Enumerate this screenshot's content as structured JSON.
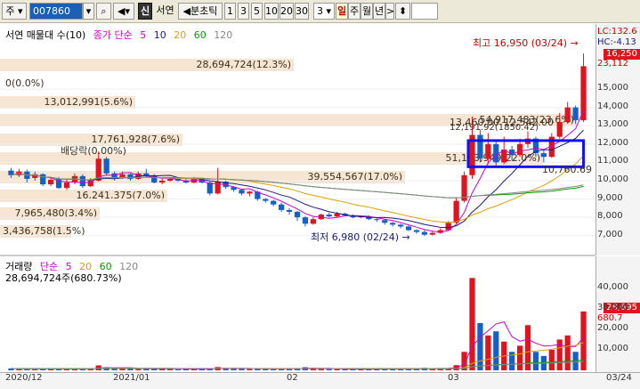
{
  "toolbar": {
    "market_select": "주",
    "code": "007860",
    "stock_name": "서연",
    "shin_badge": "신",
    "period_label": "분초틱",
    "period_buttons": [
      "1",
      "3",
      "5",
      "10",
      "20",
      "30"
    ],
    "count_value": "3",
    "day_button": "일",
    "week_button": "주",
    "month_button": "월",
    "year_button": "년"
  },
  "price_panel": {
    "legend_title": "서연 매물대 수(10)",
    "ma_label": "종가 단순",
    "ma_periods": [
      "5",
      "10",
      "20",
      "60",
      "120"
    ],
    "ma_colors": [
      "#cc00cc",
      "#1a1a80",
      "#e0a000",
      "#00a000",
      "#888888"
    ],
    "volume_profile": [
      "28,694,724(12.3%)",
      "0(0.0%)",
      "13,012,991(5.6%)",
      "54,917,483(23.6%)",
      "17,761,928(7.6%)",
      "51,103,949(22.0%)",
      "39,554,567(17.0%)",
      "16,241,375(7.0%)",
      "7,965,480(3.4%)",
      "3,436,758(1.5%)"
    ],
    "annotations": {
      "dividend": "배당락(0.00%)",
      "high": "최고 16,950 (03/24)",
      "low": "최저 6,980 (02/24)",
      "box_upper": "13,460.00",
      "box_upper_pct": "12,542.00",
      "box_mid": "12,191.92(1850.42)",
      "box_lower": "10,760.69"
    },
    "right_labels": {
      "lc": "LC:132.6",
      "hc": "HC:-4.13",
      "last_price": "16,250",
      "prev": "23,112"
    },
    "y_ticks": [
      "15,000",
      "14,000",
      "13,000",
      "12,000",
      "11,000",
      "10,000",
      "9,000",
      "8,000",
      "7,000"
    ]
  },
  "volume_panel": {
    "legend_title": "거래량",
    "ma_label": "단순",
    "ma_periods": [
      "5",
      "20",
      "60",
      "120"
    ],
    "ma_colors": [
      "#cc00cc",
      "#e0a000",
      "#00a000",
      "#888888"
    ],
    "last_volume_text": "28,694,724주(680.73%)",
    "right_labels": {
      "last_volume": "28,695",
      "pct": "680.7"
    },
    "y_ticks": [
      "40,000",
      "30,000",
      "20,000",
      "10,000"
    ]
  },
  "x_axis": {
    "labels": [
      "2020/12",
      "2021/01",
      "02",
      "03",
      "03/24"
    ]
  },
  "colors": {
    "up": "#e0141e",
    "down": "#1460c8",
    "band": "#f6e5d3",
    "box": "#1010ff"
  },
  "chart_data": {
    "type": "candlestick",
    "price_range": [
      6500,
      16950
    ],
    "volume_range": [
      0,
      46000
    ],
    "x_categories": [
      "2020/12",
      "2021/01",
      "02",
      "03",
      "03/24"
    ],
    "ma_series": [
      {
        "name": "5"
      },
      {
        "name": "10"
      },
      {
        "name": "20"
      },
      {
        "name": "60"
      },
      {
        "name": "120"
      }
    ],
    "candles": [
      {
        "o": 10550,
        "c": 10300,
        "h": 10700,
        "l": 10150
      },
      {
        "o": 10300,
        "c": 10500,
        "h": 10650,
        "l": 10200
      },
      {
        "o": 10500,
        "c": 10100,
        "h": 10600,
        "l": 9900
      },
      {
        "o": 10150,
        "c": 10350,
        "h": 10500,
        "l": 10000
      },
      {
        "o": 10350,
        "c": 9800,
        "h": 10400,
        "l": 9700
      },
      {
        "o": 9800,
        "c": 10050,
        "h": 10200,
        "l": 9700
      },
      {
        "o": 10100,
        "c": 9600,
        "h": 10200,
        "l": 9550
      },
      {
        "o": 9600,
        "c": 9900,
        "h": 10050,
        "l": 9500
      },
      {
        "o": 9900,
        "c": 10250,
        "h": 10400,
        "l": 9800
      },
      {
        "o": 10250,
        "c": 9700,
        "h": 10350,
        "l": 9600
      },
      {
        "o": 9700,
        "c": 10000,
        "h": 10150,
        "l": 9650
      },
      {
        "o": 10000,
        "c": 11200,
        "h": 11600,
        "l": 9950
      },
      {
        "o": 11200,
        "c": 10400,
        "h": 11300,
        "l": 10300
      },
      {
        "o": 10400,
        "c": 10150,
        "h": 10500,
        "l": 10000
      },
      {
        "o": 10150,
        "c": 10350,
        "h": 10500,
        "l": 10100
      },
      {
        "o": 10350,
        "c": 10100,
        "h": 10400,
        "l": 10000
      },
      {
        "o": 10100,
        "c": 10400,
        "h": 10500,
        "l": 10050
      },
      {
        "o": 10400,
        "c": 10300,
        "h": 10650,
        "l": 10200
      },
      {
        "o": 10300,
        "c": 9900,
        "h": 10350,
        "l": 9850
      },
      {
        "o": 9900,
        "c": 10000,
        "h": 10100,
        "l": 9800
      },
      {
        "o": 10000,
        "c": 10100,
        "h": 10150,
        "l": 9950
      },
      {
        "o": 10100,
        "c": 10000,
        "h": 10150,
        "l": 9950
      },
      {
        "o": 10000,
        "c": 9900,
        "h": 10100,
        "l": 9850
      },
      {
        "o": 9900,
        "c": 10100,
        "h": 10200,
        "l": 9850
      },
      {
        "o": 10100,
        "c": 9900,
        "h": 10150,
        "l": 9850
      },
      {
        "o": 9900,
        "c": 9300,
        "h": 9950,
        "l": 9200
      },
      {
        "o": 9300,
        "c": 9950,
        "h": 10700,
        "l": 9250
      },
      {
        "o": 9950,
        "c": 9650,
        "h": 10000,
        "l": 9550
      },
      {
        "o": 9650,
        "c": 9500,
        "h": 9700,
        "l": 9400
      },
      {
        "o": 9500,
        "c": 9300,
        "h": 9550,
        "l": 9200
      },
      {
        "o": 9300,
        "c": 9400,
        "h": 9450,
        "l": 9150
      },
      {
        "o": 9400,
        "c": 9000,
        "h": 9450,
        "l": 8900
      },
      {
        "o": 9000,
        "c": 8900,
        "h": 9050,
        "l": 8800
      },
      {
        "o": 8900,
        "c": 8700,
        "h": 8950,
        "l": 8600
      },
      {
        "o": 8700,
        "c": 8400,
        "h": 8800,
        "l": 8300
      },
      {
        "o": 8400,
        "c": 8300,
        "h": 8500,
        "l": 8150
      },
      {
        "o": 8300,
        "c": 8000,
        "h": 8350,
        "l": 7800
      },
      {
        "o": 8000,
        "c": 7650,
        "h": 8050,
        "l": 7500
      },
      {
        "o": 7650,
        "c": 7900,
        "h": 8000,
        "l": 7600
      },
      {
        "o": 7900,
        "c": 8150,
        "h": 8200,
        "l": 7850
      },
      {
        "o": 8150,
        "c": 8050,
        "h": 8250,
        "l": 8000
      },
      {
        "o": 8050,
        "c": 8200,
        "h": 8300,
        "l": 8000
      },
      {
        "o": 8200,
        "c": 8100,
        "h": 8250,
        "l": 8050
      },
      {
        "o": 8100,
        "c": 8000,
        "h": 8150,
        "l": 7950
      },
      {
        "o": 8000,
        "c": 8050,
        "h": 8100,
        "l": 7950
      },
      {
        "o": 8050,
        "c": 7900,
        "h": 8100,
        "l": 7850
      },
      {
        "o": 7900,
        "c": 7850,
        "h": 7950,
        "l": 7750
      },
      {
        "o": 7850,
        "c": 7700,
        "h": 7900,
        "l": 7600
      },
      {
        "o": 7700,
        "c": 7600,
        "h": 7750,
        "l": 7500
      },
      {
        "o": 7600,
        "c": 7500,
        "h": 7650,
        "l": 7400
      },
      {
        "o": 7500,
        "c": 7300,
        "h": 7550,
        "l": 7250
      },
      {
        "o": 7300,
        "c": 7200,
        "h": 7350,
        "l": 7100
      },
      {
        "o": 7200,
        "c": 7050,
        "h": 7300,
        "l": 6980
      },
      {
        "o": 7050,
        "c": 7150,
        "h": 7250,
        "l": 7000
      },
      {
        "o": 7150,
        "c": 7300,
        "h": 7400,
        "l": 7100
      },
      {
        "o": 7300,
        "c": 7700,
        "h": 7800,
        "l": 7250
      },
      {
        "o": 7700,
        "c": 8900,
        "h": 9100,
        "l": 7650
      },
      {
        "o": 8900,
        "c": 10300,
        "h": 10500,
        "l": 8800
      },
      {
        "o": 10300,
        "c": 12500,
        "h": 13500,
        "l": 10100
      },
      {
        "o": 12500,
        "c": 11200,
        "h": 12800,
        "l": 11000
      },
      {
        "o": 11200,
        "c": 12000,
        "h": 12600,
        "l": 10900
      },
      {
        "o": 12000,
        "c": 11000,
        "h": 12200,
        "l": 10800
      },
      {
        "o": 11000,
        "c": 11700,
        "h": 12400,
        "l": 10900
      },
      {
        "o": 11700,
        "c": 11400,
        "h": 11900,
        "l": 11100
      },
      {
        "o": 11400,
        "c": 12000,
        "h": 12300,
        "l": 11300
      },
      {
        "o": 12000,
        "c": 12300,
        "h": 12700,
        "l": 11800
      },
      {
        "o": 12300,
        "c": 11500,
        "h": 12400,
        "l": 11300
      },
      {
        "o": 11500,
        "c": 11300,
        "h": 11700,
        "l": 11000
      },
      {
        "o": 11300,
        "c": 12400,
        "h": 12600,
        "l": 11250
      },
      {
        "o": 12400,
        "c": 13200,
        "h": 13700,
        "l": 12300
      },
      {
        "o": 13200,
        "c": 14000,
        "h": 14300,
        "l": 13100
      },
      {
        "o": 14000,
        "c": 13300,
        "h": 14100,
        "l": 13100
      },
      {
        "o": 13300,
        "c": 16250,
        "h": 16950,
        "l": 13200
      }
    ],
    "volumes": [
      900,
      700,
      900,
      600,
      1000,
      700,
      900,
      600,
      800,
      900,
      700,
      2400,
      1500,
      900,
      700,
      800,
      600,
      900,
      1000,
      700,
      600,
      500,
      700,
      600,
      700,
      900,
      1600,
      900,
      800,
      700,
      600,
      800,
      700,
      600,
      900,
      800,
      1100,
      1500,
      800,
      700,
      600,
      600,
      500,
      600,
      500,
      600,
      700,
      800,
      700,
      600,
      900,
      800,
      1200,
      900,
      800,
      1000,
      2500,
      9000,
      45000,
      23000,
      17000,
      19000,
      14000,
      9000,
      12000,
      22000,
      9000,
      7000,
      10000,
      15000,
      17000,
      9000,
      28695
    ]
  }
}
